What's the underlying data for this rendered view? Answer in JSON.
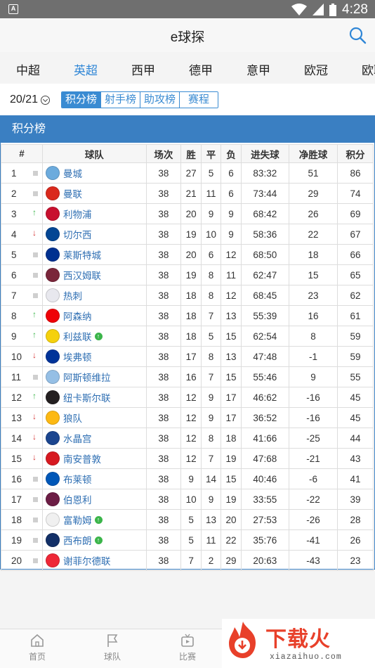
{
  "status_bar": {
    "time": "4:28",
    "app_badge": "A"
  },
  "app": {
    "title": "e球探"
  },
  "league_tabs": [
    {
      "label": "中超",
      "active": false
    },
    {
      "label": "英超",
      "active": true
    },
    {
      "label": "西甲",
      "active": false
    },
    {
      "label": "德甲",
      "active": false
    },
    {
      "label": "意甲",
      "active": false
    },
    {
      "label": "欧冠",
      "active": false
    },
    {
      "label": "欧联",
      "active": false
    }
  ],
  "season": {
    "value": "20/21"
  },
  "segments": [
    {
      "label": "积分榜",
      "active": true
    },
    {
      "label": "射手榜",
      "active": false
    },
    {
      "label": "助攻榜",
      "active": false
    },
    {
      "label": "赛程",
      "active": false
    }
  ],
  "standings": {
    "title": "积分榜",
    "columns": [
      "#",
      "球队",
      "场次",
      "胜",
      "平",
      "负",
      "进失球",
      "净胜球",
      "积分"
    ],
    "rows": [
      {
        "rank": "1",
        "trend": "same",
        "team": "曼城",
        "crest": "#6cabdd",
        "promoted": false,
        "played": "38",
        "w": "27",
        "d": "5",
        "l": "6",
        "goals": "83:32",
        "gd": "51",
        "pts": "86"
      },
      {
        "rank": "2",
        "trend": "same",
        "team": "曼联",
        "crest": "#da291c",
        "promoted": false,
        "played": "38",
        "w": "21",
        "d": "11",
        "l": "6",
        "goals": "73:44",
        "gd": "29",
        "pts": "74"
      },
      {
        "rank": "3",
        "trend": "up",
        "team": "利物浦",
        "crest": "#c8102e",
        "promoted": false,
        "played": "38",
        "w": "20",
        "d": "9",
        "l": "9",
        "goals": "68:42",
        "gd": "26",
        "pts": "69"
      },
      {
        "rank": "4",
        "trend": "down",
        "team": "切尔西",
        "crest": "#034694",
        "promoted": false,
        "played": "38",
        "w": "19",
        "d": "10",
        "l": "9",
        "goals": "58:36",
        "gd": "22",
        "pts": "67"
      },
      {
        "rank": "5",
        "trend": "same",
        "team": "莱斯特城",
        "crest": "#003090",
        "promoted": false,
        "played": "38",
        "w": "20",
        "d": "6",
        "l": "12",
        "goals": "68:50",
        "gd": "18",
        "pts": "66"
      },
      {
        "rank": "6",
        "trend": "same",
        "team": "西汉姆联",
        "crest": "#7a263a",
        "promoted": false,
        "played": "38",
        "w": "19",
        "d": "8",
        "l": "11",
        "goals": "62:47",
        "gd": "15",
        "pts": "65"
      },
      {
        "rank": "7",
        "trend": "same",
        "team": "热刺",
        "crest": "#e8e8ee",
        "promoted": false,
        "played": "38",
        "w": "18",
        "d": "8",
        "l": "12",
        "goals": "68:45",
        "gd": "23",
        "pts": "62"
      },
      {
        "rank": "8",
        "trend": "up",
        "team": "阿森纳",
        "crest": "#ef0107",
        "promoted": false,
        "played": "38",
        "w": "18",
        "d": "7",
        "l": "13",
        "goals": "55:39",
        "gd": "16",
        "pts": "61"
      },
      {
        "rank": "9",
        "trend": "up",
        "team": "利兹联",
        "crest": "#f5d10d",
        "promoted": true,
        "played": "38",
        "w": "18",
        "d": "5",
        "l": "15",
        "goals": "62:54",
        "gd": "8",
        "pts": "59"
      },
      {
        "rank": "10",
        "trend": "down",
        "team": "埃弗顿",
        "crest": "#003399",
        "promoted": false,
        "played": "38",
        "w": "17",
        "d": "8",
        "l": "13",
        "goals": "47:48",
        "gd": "-1",
        "pts": "59"
      },
      {
        "rank": "11",
        "trend": "same",
        "team": "阿斯顿维拉",
        "crest": "#95bfe5",
        "promoted": false,
        "played": "38",
        "w": "16",
        "d": "7",
        "l": "15",
        "goals": "55:46",
        "gd": "9",
        "pts": "55"
      },
      {
        "rank": "12",
        "trend": "up",
        "team": "纽卡斯尔联",
        "crest": "#241f20",
        "promoted": false,
        "played": "38",
        "w": "12",
        "d": "9",
        "l": "17",
        "goals": "46:62",
        "gd": "-16",
        "pts": "45"
      },
      {
        "rank": "13",
        "trend": "down",
        "team": "狼队",
        "crest": "#fdb913",
        "promoted": false,
        "played": "38",
        "w": "12",
        "d": "9",
        "l": "17",
        "goals": "36:52",
        "gd": "-16",
        "pts": "45"
      },
      {
        "rank": "14",
        "trend": "down",
        "team": "水晶宫",
        "crest": "#1b458f",
        "promoted": false,
        "played": "38",
        "w": "12",
        "d": "8",
        "l": "18",
        "goals": "41:66",
        "gd": "-25",
        "pts": "44"
      },
      {
        "rank": "15",
        "trend": "down",
        "team": "南安普敦",
        "crest": "#d71920",
        "promoted": false,
        "played": "38",
        "w": "12",
        "d": "7",
        "l": "19",
        "goals": "47:68",
        "gd": "-21",
        "pts": "43"
      },
      {
        "rank": "16",
        "trend": "same",
        "team": "布莱顿",
        "crest": "#0057b8",
        "promoted": false,
        "played": "38",
        "w": "9",
        "d": "14",
        "l": "15",
        "goals": "40:46",
        "gd": "-6",
        "pts": "41"
      },
      {
        "rank": "17",
        "trend": "same",
        "team": "伯恩利",
        "crest": "#6c1d45",
        "promoted": false,
        "played": "38",
        "w": "10",
        "d": "9",
        "l": "19",
        "goals": "33:55",
        "gd": "-22",
        "pts": "39"
      },
      {
        "rank": "18",
        "trend": "same",
        "team": "富勒姆",
        "crest": "#f0f0f0",
        "promoted": true,
        "played": "38",
        "w": "5",
        "d": "13",
        "l": "20",
        "goals": "27:53",
        "gd": "-26",
        "pts": "28"
      },
      {
        "rank": "19",
        "trend": "same",
        "team": "西布朗",
        "crest": "#122f67",
        "promoted": true,
        "played": "38",
        "w": "5",
        "d": "11",
        "l": "22",
        "goals": "35:76",
        "gd": "-41",
        "pts": "26"
      },
      {
        "rank": "20",
        "trend": "same",
        "team": "谢菲尔德联",
        "crest": "#ee2737",
        "promoted": false,
        "played": "38",
        "w": "7",
        "d": "2",
        "l": "29",
        "goals": "20:63",
        "gd": "-43",
        "pts": "23"
      }
    ]
  },
  "bottom_nav": [
    {
      "label": "首页",
      "icon": "home-icon"
    },
    {
      "label": "球队",
      "icon": "flag-icon"
    },
    {
      "label": "比赛",
      "icon": "tv-icon"
    }
  ],
  "watermark": {
    "brand": "下载火",
    "url": "xiazaihuo.com"
  },
  "colors": {
    "accent": "#3a7fc2",
    "tab_active": "#2f86d6",
    "up": "#3bb54a",
    "down": "#d53232"
  }
}
